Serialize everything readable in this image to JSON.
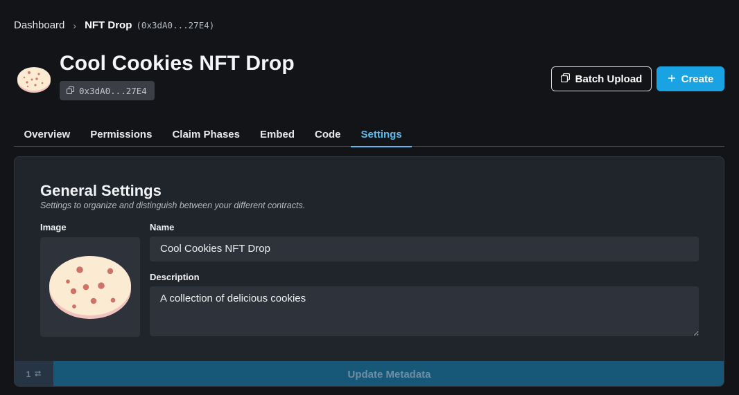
{
  "breadcrumb": {
    "root": "Dashboard",
    "separator": "›",
    "current": "NFT Drop",
    "address": "(0x3dA0...27E4)"
  },
  "header": {
    "title": "Cool Cookies NFT Drop",
    "address": "0x3dA0...27E4",
    "batch_upload_label": "Batch Upload",
    "create_label": "Create"
  },
  "tabs": [
    {
      "label": "Overview",
      "active": false
    },
    {
      "label": "Permissions",
      "active": false
    },
    {
      "label": "Claim Phases",
      "active": false
    },
    {
      "label": "Embed",
      "active": false
    },
    {
      "label": "Code",
      "active": false
    },
    {
      "label": "Settings",
      "active": true
    }
  ],
  "settings": {
    "title": "General Settings",
    "subtitle": "Settings to organize and distinguish between your different contracts.",
    "image_label": "Image",
    "name_label": "Name",
    "name_value": "Cool Cookies NFT Drop",
    "description_label": "Description",
    "description_value": "A collection of delicious cookies",
    "counter": "1",
    "update_label": "Update Metadata"
  },
  "colors": {
    "background": "#131417",
    "accent": "#1aa3e3",
    "tab_active": "#5dbbee",
    "card": "#20242b",
    "input": "#2e323a"
  },
  "icons": {
    "avatar": "cookie-icon",
    "copy": "copy-icon",
    "batch": "batch-upload-icon",
    "create": "plus-icon",
    "counter": "swap-arrows-icon"
  }
}
